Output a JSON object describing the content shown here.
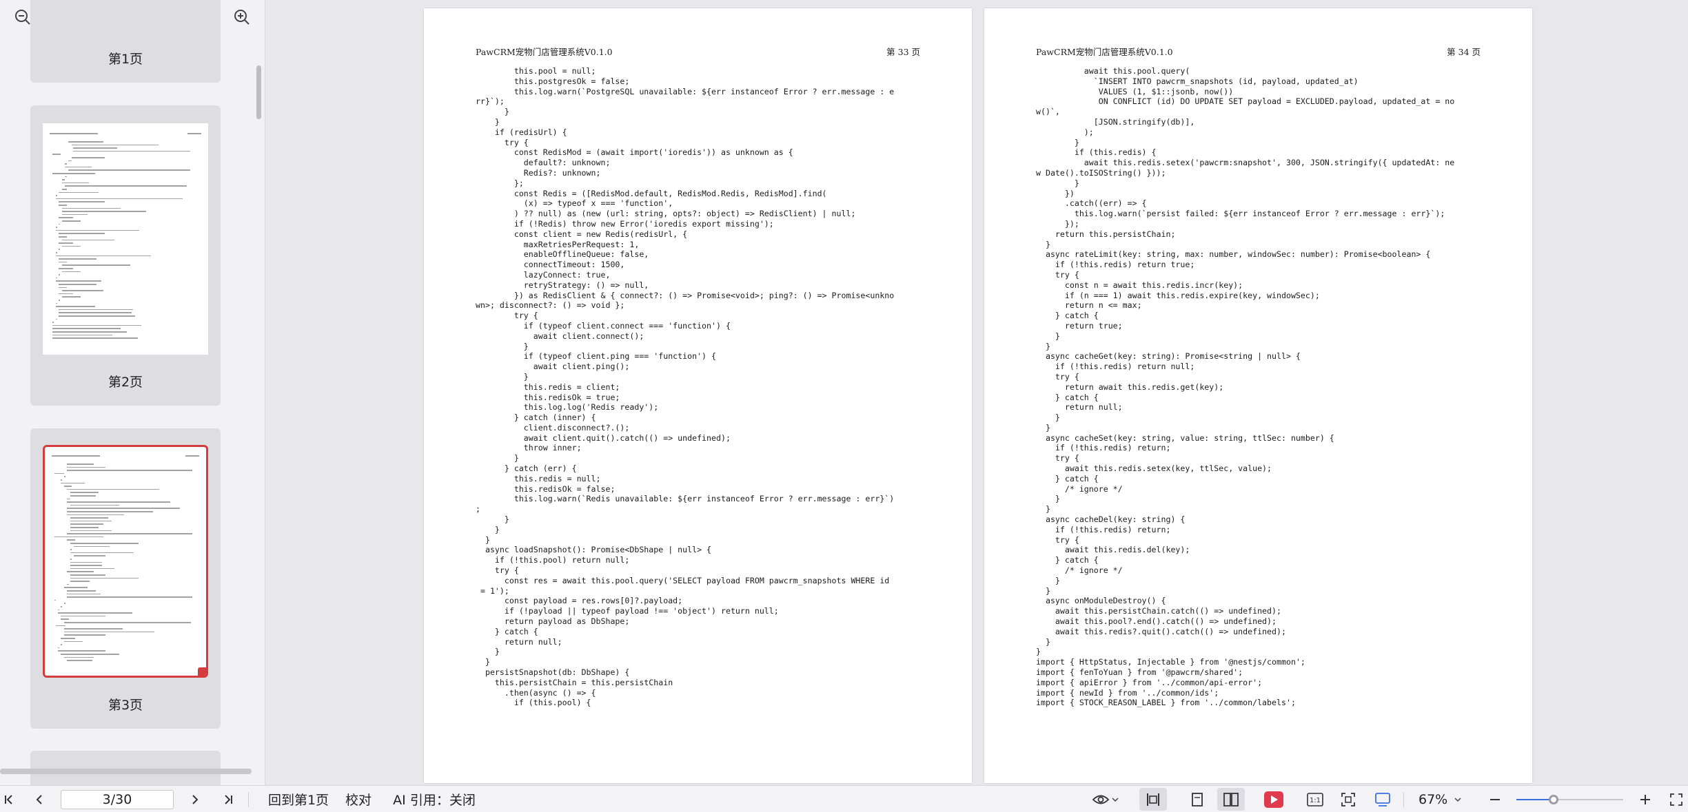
{
  "sidebar": {
    "thumbnail_zoom_fraction": 0.11,
    "thumbnails": [
      {
        "label": "第1页",
        "selected": false
      },
      {
        "label": "第2页",
        "selected": false
      },
      {
        "label": "第3页",
        "selected": true
      }
    ]
  },
  "document": {
    "header_title": "PawCRM宠物门店管理系统V0.1.0",
    "pages": [
      {
        "number_label": "第 33 页",
        "lines": [
          "        this.pool = null;",
          "        this.postgresOk = false;",
          "        this.log.warn(`PostgreSQL unavailable: ${err instanceof Error ? err.message : e",
          "rr}`);",
          "      }",
          "    }",
          "    if (redisUrl) {",
          "      try {",
          "        const RedisMod = (await import('ioredis')) as unknown as {",
          "          default?: unknown;",
          "          Redis?: unknown;",
          "        };",
          "        const Redis = ([RedisMod.default, RedisMod.Redis, RedisMod].find(",
          "          (x) => typeof x === 'function',",
          "        ) ?? null) as (new (url: string, opts?: object) => RedisClient) | null;",
          "        if (!Redis) throw new Error('ioredis export missing');",
          "        const client = new Redis(redisUrl, {",
          "          maxRetriesPerRequest: 1,",
          "          enableOfflineQueue: false,",
          "          connectTimeout: 1500,",
          "          lazyConnect: true,",
          "          retryStrategy: () => null,",
          "        }) as RedisClient & { connect?: () => Promise<void>; ping?: () => Promise<unkno",
          "wn>; disconnect?: () => void };",
          "        try {",
          "          if (typeof client.connect === 'function') {",
          "            await client.connect();",
          "          }",
          "          if (typeof client.ping === 'function') {",
          "            await client.ping();",
          "          }",
          "          this.redis = client;",
          "          this.redisOk = true;",
          "          this.log.log('Redis ready');",
          "        } catch (inner) {",
          "          client.disconnect?.();",
          "          await client.quit().catch(() => undefined);",
          "          throw inner;",
          "        }",
          "      } catch (err) {",
          "        this.redis = null;",
          "        this.redisOk = false;",
          "        this.log.warn(`Redis unavailable: ${err instanceof Error ? err.message : err}`)",
          ";",
          "      }",
          "    }",
          "  }",
          "  async loadSnapshot(): Promise<DbShape | null> {",
          "    if (!this.pool) return null;",
          "    try {",
          "      const res = await this.pool.query('SELECT payload FROM pawcrm_snapshots WHERE id",
          " = 1');",
          "      const payload = res.rows[0]?.payload;",
          "      if (!payload || typeof payload !== 'object') return null;",
          "      return payload as DbShape;",
          "    } catch {",
          "      return null;",
          "    }",
          "  }",
          "  persistSnapshot(db: DbShape) {",
          "    this.persistChain = this.persistChain",
          "      .then(async () => {",
          "        if (this.pool) {"
        ]
      },
      {
        "number_label": "第 34 页",
        "lines": [
          "          await this.pool.query(",
          "            `INSERT INTO pawcrm_snapshots (id, payload, updated_at)",
          "             VALUES (1, $1::jsonb, now())",
          "             ON CONFLICT (id) DO UPDATE SET payload = EXCLUDED.payload, updated_at = no",
          "w()`,",
          "            [JSON.stringify(db)],",
          "          );",
          "        }",
          "        if (this.redis) {",
          "          await this.redis.setex('pawcrm:snapshot', 300, JSON.stringify({ updatedAt: ne",
          "w Date().toISOString() }));",
          "        }",
          "      })",
          "      .catch((err) => {",
          "        this.log.warn(`persist failed: ${err instanceof Error ? err.message : err}`);",
          "      });",
          "    return this.persistChain;",
          "  }",
          "  async rateLimit(key: string, max: number, windowSec: number): Promise<boolean> {",
          "    if (!this.redis) return true;",
          "    try {",
          "      const n = await this.redis.incr(key);",
          "      if (n === 1) await this.redis.expire(key, windowSec);",
          "      return n <= max;",
          "    } catch {",
          "      return true;",
          "    }",
          "  }",
          "  async cacheGet(key: string): Promise<string | null> {",
          "    if (!this.redis) return null;",
          "    try {",
          "      return await this.redis.get(key);",
          "    } catch {",
          "      return null;",
          "    }",
          "  }",
          "  async cacheSet(key: string, value: string, ttlSec: number) {",
          "    if (!this.redis) return;",
          "    try {",
          "      await this.redis.setex(key, ttlSec, value);",
          "    } catch {",
          "      /* ignore */",
          "    }",
          "  }",
          "  async cacheDel(key: string) {",
          "    if (!this.redis) return;",
          "    try {",
          "      await this.redis.del(key);",
          "    } catch {",
          "      /* ignore */",
          "    }",
          "  }",
          "  async onModuleDestroy() {",
          "    await this.persistChain.catch(() => undefined);",
          "    await this.pool?.end().catch(() => undefined);",
          "    await this.redis?.quit().catch(() => undefined);",
          "  }",
          "}",
          "import { HttpStatus, Injectable } from '@nestjs/common';",
          "import { fenToYuan } from '@pawcrm/shared';",
          "import { apiError } from '../common/api-error';",
          "import { newId } from '../common/ids';",
          "import { STOCK_REASON_LABEL } from '../common/labels';"
        ]
      }
    ]
  },
  "bottombar": {
    "page_input": "3/30",
    "goto_first_label": "回到第1页",
    "proofread_label": "校对",
    "ai_quote_label": "AI 引用：关闭",
    "zoom_label": "67%",
    "zoom_fraction": 0.35,
    "accent_color": "#3b6fe0",
    "play_color": "#e03a4c"
  }
}
